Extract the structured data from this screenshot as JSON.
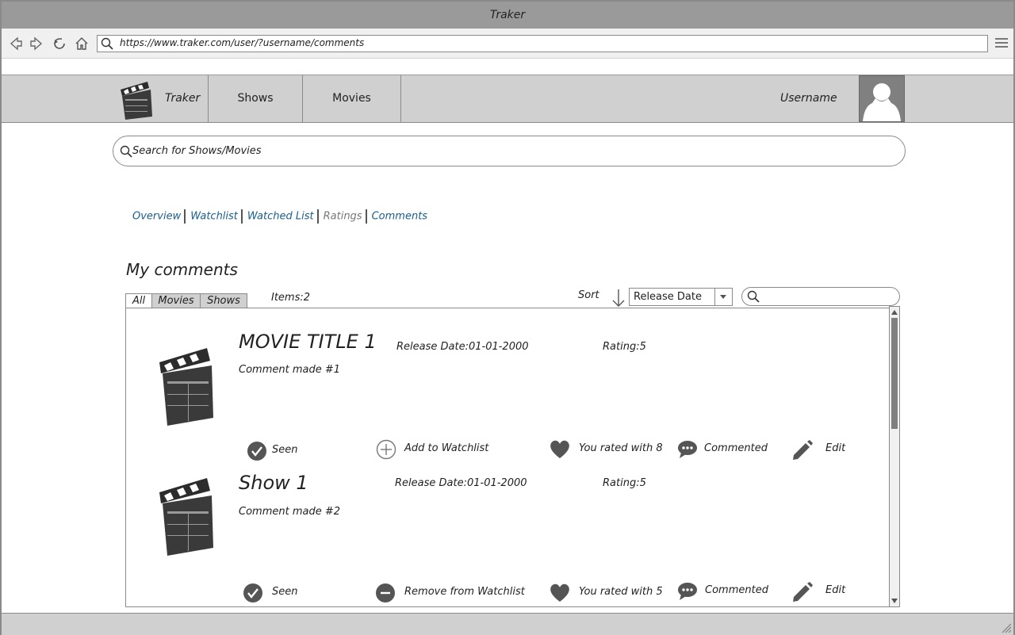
{
  "window": {
    "title": "Traker"
  },
  "browser": {
    "url": "https://www.traker.com/user/?username/comments"
  },
  "nav": {
    "brand": "Traker",
    "items": [
      "Shows",
      "Movies"
    ],
    "username": "Username"
  },
  "search": {
    "placeholder": "Search for Shows/Movies"
  },
  "subnav": {
    "overview": "Overview",
    "watchlist": "Watchlist",
    "watched": "Watched List",
    "ratings": "Ratings",
    "comments": "Comments"
  },
  "page": {
    "heading": "My comments"
  },
  "filters": {
    "tabs": [
      "All",
      "Movies",
      "Shows"
    ],
    "items_count": "Items:2",
    "sort_label": "Sort",
    "sort_value": "Release Date"
  },
  "entries": [
    {
      "title": "MOVIE TITLE 1",
      "release": "Release Date:01-01-2000",
      "rating": "Rating:5",
      "comment": "Comment made #1",
      "actions": {
        "seen": "Seen",
        "watchlist": "Add to Watchlist",
        "rated": "You rated with 8",
        "commented": "Commented",
        "edit": "Edit"
      }
    },
    {
      "title": "Show 1",
      "release": "Release Date:01-01-2000",
      "rating": "Rating:5",
      "comment": "Comment made #2",
      "actions": {
        "seen": "Seen",
        "watchlist": "Remove from Watchlist",
        "rated": "You rated with 5",
        "commented": "Commented",
        "edit": "Edit"
      }
    }
  ],
  "icons": [
    "back-icon",
    "forward-icon",
    "reload-icon",
    "home-icon",
    "search-icon",
    "menu-icon",
    "clapperboard-icon",
    "avatar-icon",
    "sort-arrow-icon",
    "dropdown-icon",
    "check-icon",
    "plus-icon",
    "minus-icon",
    "heart-icon",
    "comment-icon",
    "pencil-icon"
  ]
}
